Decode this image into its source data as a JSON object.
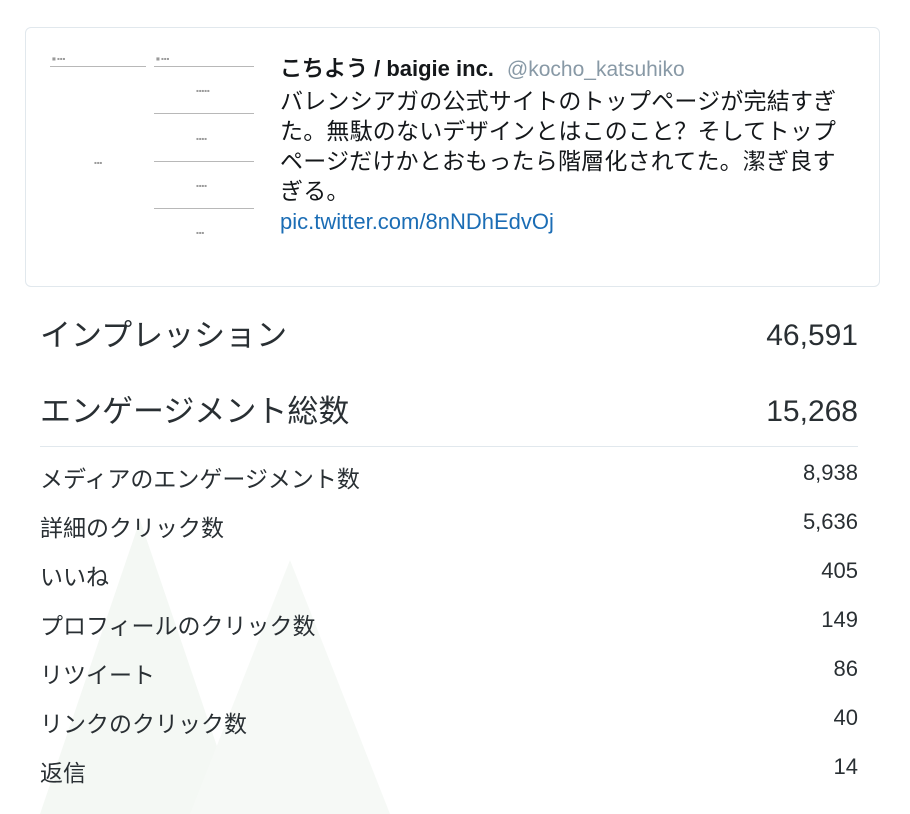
{
  "tweet": {
    "author_name": "こちよう / baigie inc.",
    "author_handle": "@kocho_katsuhiko",
    "text": "バレンシアガの公式サイトのトップページが完結すぎた。無駄のないデザインとはこのこと？そしてトップページだけかとおもったら階層化されてた。潔ぎ良すぎる。",
    "link": "pic.twitter.com/8nNDhEdvOj"
  },
  "metrics": {
    "impressions": {
      "label": "インプレッション",
      "value": "46,591"
    },
    "engagements": {
      "label": "エンゲージメント総数",
      "value": "15,268"
    }
  },
  "details": [
    {
      "label": "メディアのエンゲージメント数",
      "value": "8,938"
    },
    {
      "label": "詳細のクリック数",
      "value": "5,636"
    },
    {
      "label": "いいね",
      "value": "405"
    },
    {
      "label": "プロフィールのクリック数",
      "value": "149"
    },
    {
      "label": "リツイート",
      "value": "86"
    },
    {
      "label": "リンクのクリック数",
      "value": "40"
    },
    {
      "label": "返信",
      "value": "14"
    }
  ],
  "colors": {
    "link": "#1b6db5",
    "handle": "#8899a6",
    "border": "#e1e8ed",
    "text": "#292f33"
  }
}
